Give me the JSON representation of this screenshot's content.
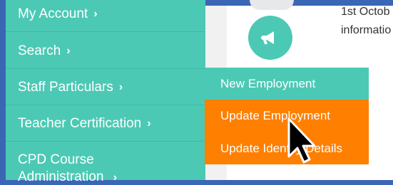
{
  "sidebar": {
    "items": [
      {
        "label": "My Account",
        "chevron": "›"
      },
      {
        "label": "Search",
        "chevron": "›"
      },
      {
        "label": "Staff Particulars",
        "chevron": "›"
      },
      {
        "label": "Teacher Certification",
        "chevron": "›"
      },
      {
        "label": "CPD Course",
        "chevron": ""
      },
      {
        "label": "Administration",
        "chevron": "›"
      }
    ]
  },
  "submenu": {
    "items": [
      {
        "label": "New Employment"
      },
      {
        "label": "Update Employment"
      },
      {
        "label": "Update Identity Details"
      }
    ]
  },
  "content": {
    "line1": "1st Octob",
    "line2": "informatio",
    "icon": "megaphone-icon"
  },
  "colors": {
    "sidebar": "#4cc9b4",
    "highlight": "#ff7f00",
    "frame": "#3b66b5"
  }
}
